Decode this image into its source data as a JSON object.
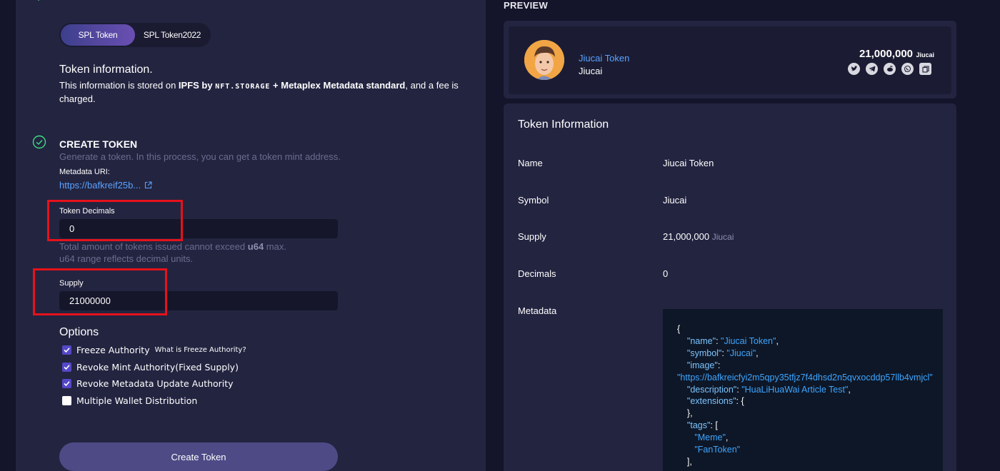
{
  "tabs": [
    {
      "label": "SPL Token",
      "active": true
    },
    {
      "label": "SPL Token2022",
      "active": false
    }
  ],
  "token_info": {
    "title": "Token information.",
    "desc_prefix": "This information is stored on ",
    "desc_bold": "IPFS by ",
    "desc_logo": "NFT.STORAGE",
    "desc_bold2": " + Metaplex Metadata standard",
    "desc_suffix": ", and a fee is charged."
  },
  "create_step": {
    "title": "CREATE TOKEN",
    "desc": "Generate a token. In this process, you can get a token mint address.",
    "metadata_label": "Metadata URI:",
    "metadata_link": "https://bafkreif25b..."
  },
  "decimals": {
    "label": "Token Decimals",
    "value": "0"
  },
  "hint": {
    "line1_prefix": "Total amount of tokens issued cannot exceed ",
    "line1_bold": "u64",
    "line1_suffix": " max.",
    "line2": "u64 range reflects decimal units."
  },
  "supply_field": {
    "label": "Supply",
    "value": "21000000"
  },
  "options": {
    "title": "Options",
    "items": [
      {
        "label": "Freeze Authority",
        "checked": true,
        "extra": "What is Freeze Authority?"
      },
      {
        "label": "Revoke Mint Authority(Fixed Supply)",
        "checked": true
      },
      {
        "label": "Revoke Metadata Update Authority",
        "checked": true
      },
      {
        "label": "Multiple Wallet Distribution",
        "checked": false
      }
    ]
  },
  "create_button": "Create Token",
  "preview": {
    "label": "PREVIEW",
    "token_name": "Jiucai Token",
    "token_symbol": "Jiucai",
    "supply": "21,000,000",
    "supply_unit": "Jiucai",
    "social_icons": [
      "twitter-icon",
      "telegram-icon",
      "reddit-icon",
      "whatsapp-icon",
      "copy-icon"
    ]
  },
  "info_card": {
    "title": "Token Information",
    "rows": [
      {
        "label": "Name",
        "value": "Jiucai Token"
      },
      {
        "label": "Symbol",
        "value": "Jiucai"
      },
      {
        "label": "Supply",
        "value": "21,000,000",
        "unit": "Jiucai"
      },
      {
        "label": "Decimals",
        "value": "0"
      },
      {
        "label": "Metadata"
      }
    ],
    "json": {
      "name": "Jiucai Token",
      "symbol": "Jiucai",
      "image": "https://bafkreicfyi2m5qpy35tfjz7f4dhsd2n5qvxocddp57llb4vmjcl",
      "description": "HuaLiHuaWai Article Test",
      "tags": [
        "Meme",
        "FanToken"
      ]
    }
  },
  "colors": {
    "background": "#14152a",
    "panel": "#232440",
    "accent_link": "#5aa3ff",
    "checkbox": "#5548c8",
    "highlight_box": "#e6121b"
  }
}
